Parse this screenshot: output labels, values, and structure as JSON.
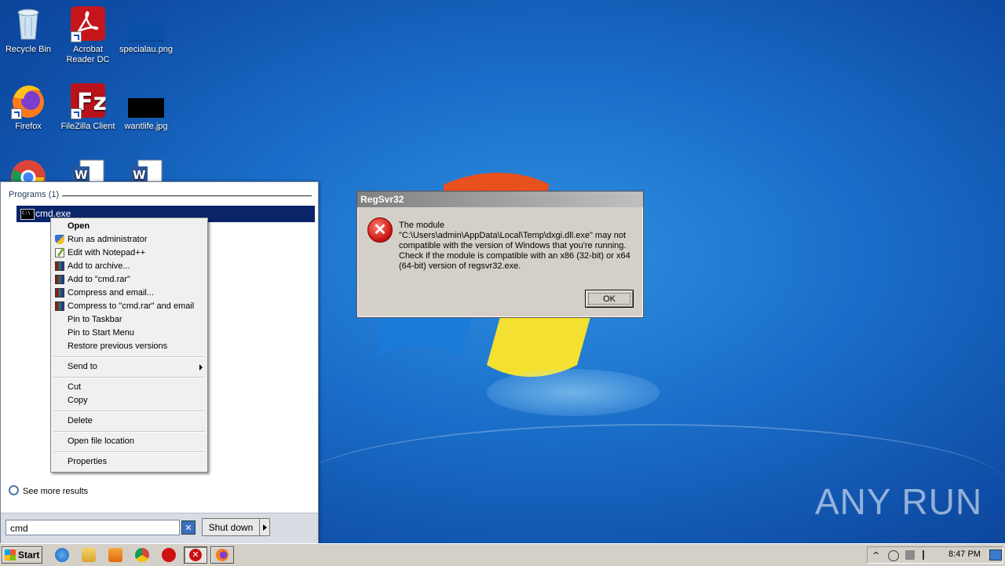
{
  "desktop": {
    "icons": [
      {
        "label": "Recycle Bin",
        "icon": "recycle-bin-icon"
      },
      {
        "label": "Acrobat Reader DC",
        "icon": "acrobat-icon"
      },
      {
        "label": "specialau.png",
        "icon": "image-file-icon"
      },
      {
        "label": "Firefox",
        "icon": "firefox-icon"
      },
      {
        "label": "FileZilla Client",
        "icon": "filezilla-icon"
      },
      {
        "label": "wantlife.jpg",
        "icon": "image-file-icon"
      },
      {
        "label": "",
        "icon": "chrome-icon"
      },
      {
        "label": "",
        "icon": "word-document-icon"
      },
      {
        "label": "",
        "icon": "word-document-icon"
      }
    ],
    "watermark": "ANY RUN"
  },
  "start_menu": {
    "programs_header": "Programs (1)",
    "result_label": "cmd.exe",
    "see_more": "See more results",
    "search_value": "cmd",
    "shutdown_label": "Shut down"
  },
  "context_menu": {
    "items": [
      "Open",
      "Run as administrator",
      "Edit with Notepad++",
      "Add to archive...",
      "Add to \"cmd.rar\"",
      "Compress and email...",
      "Compress to \"cmd.rar\" and email",
      "Pin to Taskbar",
      "Pin to Start Menu",
      "Restore previous versions",
      "Send to",
      "Cut",
      "Copy",
      "Delete",
      "Open file location",
      "Properties"
    ]
  },
  "dialog": {
    "title": "RegSvr32",
    "message_lines": [
      "The module",
      "\"C:\\Users\\admin\\AppData\\Local\\Temp\\dxgi.dll.exe\" may not",
      "compatible with the version of Windows that you're running.",
      "Check if the module is compatible with an x86 (32-bit) or x64",
      "(64-bit) version of regsvr32.exe."
    ],
    "ok_label": "OK"
  },
  "taskbar": {
    "start_label": "Start",
    "clock": "8:47 PM"
  }
}
